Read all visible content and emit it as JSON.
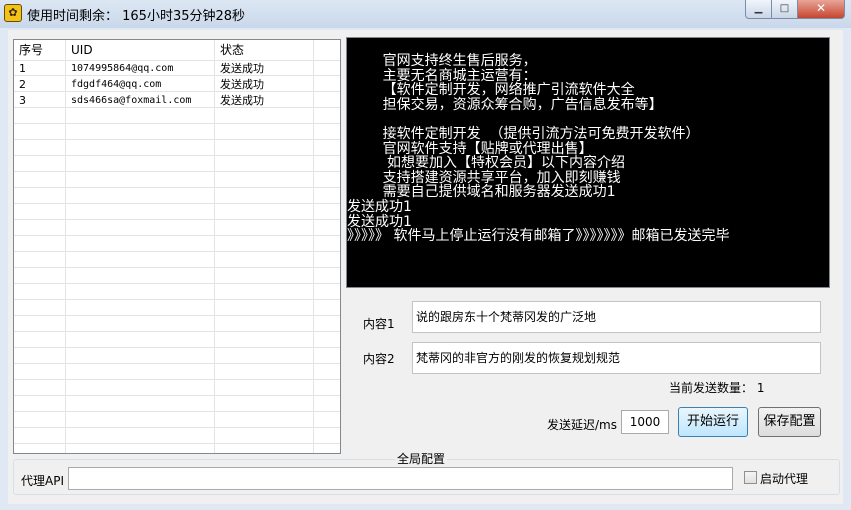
{
  "window": {
    "title": "使用时间剩余：  165小时35分钟28秒",
    "icon": "app-logo-icon"
  },
  "table": {
    "columns": [
      "序号",
      "UID",
      "状态"
    ],
    "rows": [
      [
        "1",
        "1074995864@qq.com",
        "发送成功"
      ],
      [
        "2",
        "fdgdf464@qq.com",
        "发送成功"
      ],
      [
        "3",
        "sds466sa@foxmail.com",
        "发送成功"
      ]
    ]
  },
  "console": {
    "lines": [
      "        官网支持终生售后服务，",
      "        主要无名商城主运营有：",
      "        【软件定制开发，网络推广引流软件大全",
      "        担保交易，资源众筹合购，广告信息发布等】",
      "",
      "        接软件定制开发  （提供引流方法可免费开发软件）",
      "        官网软件支持【贴牌或代理出售】",
      "         如想要加入【特权会员】以下内容介绍",
      "        支持搭建资源共享平台，加入即刻赚钱",
      "        需要自己提供域名和服务器发送成功1",
      "发送成功1",
      "发送成功1",
      "》》》》》 软件马上停止运行没有邮箱了》》》》》》》邮箱已发送完毕"
    ]
  },
  "form": {
    "content1_label": "内容1",
    "content1_value": "说的跟房东十个梵蒂冈发的广泛地",
    "content2_label": "内容2",
    "content2_value": "梵蒂冈的非官方的刚发的恢复规划规范",
    "count_label": "当前发送数量：  1",
    "delay_label": "发送延迟/ms",
    "delay_value": "1000",
    "start_button": "开始运行",
    "save_button": "保存配置"
  },
  "global": {
    "group_title": "全局配置",
    "proxy_label": "代理API",
    "proxy_value": "",
    "proxy_toggle_label": "启动代理"
  }
}
